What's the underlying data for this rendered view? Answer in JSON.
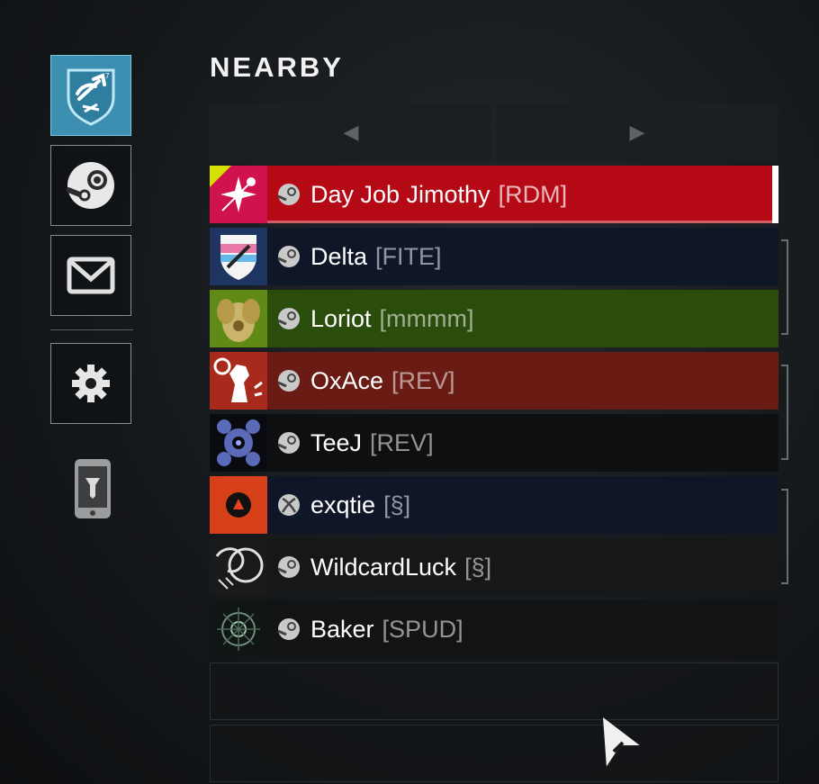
{
  "title": "NEARBY",
  "rail": {
    "items": [
      {
        "name": "clan-tab",
        "icon": "clan-shield-icon",
        "active": true
      },
      {
        "name": "steam-tab",
        "icon": "steam-icon",
        "active": false
      },
      {
        "name": "mail-tab",
        "icon": "mail-icon",
        "active": false
      },
      {
        "name": "settings-tab",
        "icon": "gear-icon",
        "active": false
      }
    ],
    "companion_icon": "companion-phone-icon"
  },
  "pager": {
    "prev_icon": "◀",
    "next_icon": "▶"
  },
  "players": [
    {
      "name": "Day Job Jimothy",
      "clan": "[RDM]",
      "platform": "steam",
      "color": "#b50a16",
      "emblem_color": "#d0134f",
      "selected": true
    },
    {
      "name": "Delta",
      "clan": "[FITE]",
      "platform": "steam",
      "color": "#0e1628",
      "emblem_color": "#1d3560",
      "selected": false
    },
    {
      "name": "Loriot",
      "clan": "[mmmm]",
      "platform": "steam",
      "color": "#2a4d0b",
      "emblem_color": "#5f8a16",
      "selected": false
    },
    {
      "name": "OxAce",
      "clan": "[REV]",
      "platform": "steam",
      "color": "#6a1c14",
      "emblem_color": "#a82a1c",
      "selected": false
    },
    {
      "name": "TeeJ",
      "clan": "[REV]",
      "platform": "steam",
      "color": "#0d0f10",
      "emblem_color": "#0a0b10",
      "selected": false
    },
    {
      "name": "exqtie",
      "clan": "[§]",
      "platform": "xbox",
      "color": "#0e1628",
      "emblem_color": "#d8401a",
      "selected": false
    },
    {
      "name": "WildcardLuck",
      "clan": "[§]",
      "platform": "steam",
      "color": "#161718",
      "emblem_color": "#1a1a1a",
      "selected": false
    },
    {
      "name": "Baker",
      "clan": "[SPUD]",
      "platform": "steam",
      "color": "#111314",
      "emblem_color": "#101614",
      "selected": false
    }
  ]
}
